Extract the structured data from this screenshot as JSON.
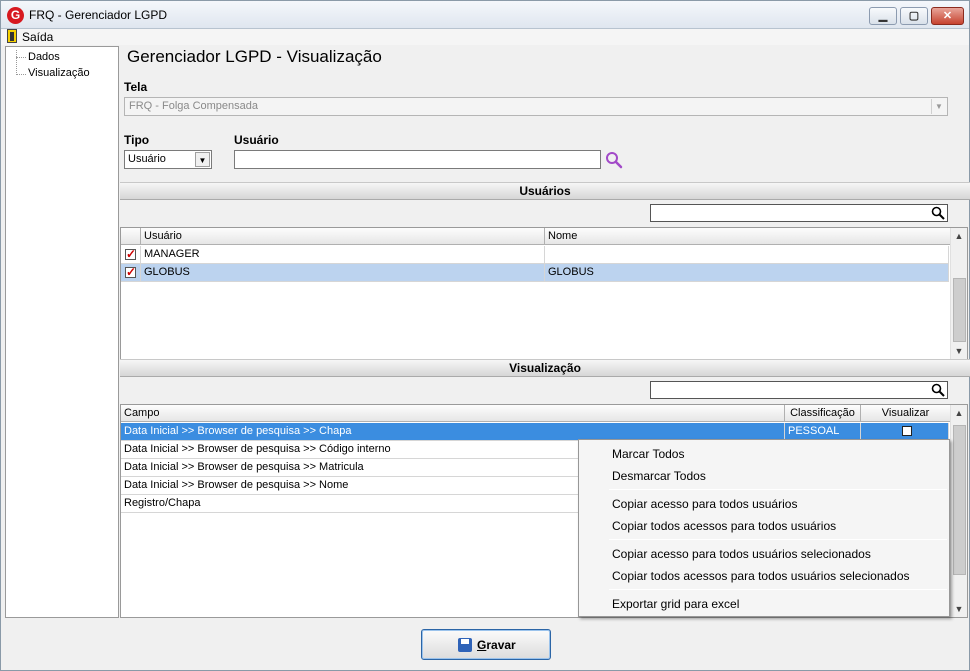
{
  "window": {
    "title": "FRQ - Gerenciador LGPD",
    "app_icon_letter": "G",
    "minimize_glyph": "▁",
    "maximize_glyph": "▢",
    "close_glyph": "✕"
  },
  "menu": {
    "exit_label": "Saída"
  },
  "tree": {
    "items": [
      {
        "label": "Dados"
      },
      {
        "label": "Visualização"
      }
    ]
  },
  "main": {
    "title": "Gerenciador LGPD - Visualização",
    "tela_label": "Tela",
    "tela_value": "FRQ - Folga Compensada",
    "tipo_label": "Tipo",
    "tipo_value": "Usuário",
    "usuario_label": "Usuário",
    "usuario_value": ""
  },
  "usuarios_section": {
    "title": "Usuários",
    "search_value": "",
    "columns": [
      "Usuário",
      "Nome"
    ],
    "rows": [
      {
        "checked": true,
        "usuario": "MANAGER",
        "nome": ""
      },
      {
        "checked": true,
        "usuario": "GLOBUS",
        "nome": "GLOBUS"
      }
    ]
  },
  "visualizacao_section": {
    "title": "Visualização",
    "search_value": "",
    "columns": [
      "Campo",
      "Classificação",
      "Visualizar"
    ],
    "rows": [
      {
        "campo": "Data Inicial >> Browser de pesquisa >> Chapa",
        "classificacao": "PESSOAL",
        "visualizar": false
      },
      {
        "campo": "Data Inicial >> Browser de pesquisa >> Código interno",
        "classificacao": "",
        "visualizar": false
      },
      {
        "campo": "Data Inicial >> Browser de pesquisa >> Matricula",
        "classificacao": "",
        "visualizar": false
      },
      {
        "campo": "Data Inicial >> Browser de pesquisa >> Nome",
        "classificacao": "",
        "visualizar": false
      },
      {
        "campo": "Registro/Chapa",
        "classificacao": "",
        "visualizar": false
      }
    ]
  },
  "context_menu": {
    "items": [
      "Marcar Todos",
      "Desmarcar Todos",
      "Copiar acesso para todos usuários",
      "Copiar todos acessos para todos usuários",
      "Copiar acesso para todos usuários selecionados",
      "Copiar todos acessos para todos usuários selecionados",
      "Exportar grid para excel"
    ]
  },
  "footer": {
    "save_label": "Gravar",
    "save_mnemonic": "G",
    "save_rest": "ravar"
  },
  "colors": {
    "selection_blue": "#3b8de0",
    "selection_light": "#bcd3ef",
    "check_red": "#cc0000",
    "search_purple": "#a24ac8"
  }
}
